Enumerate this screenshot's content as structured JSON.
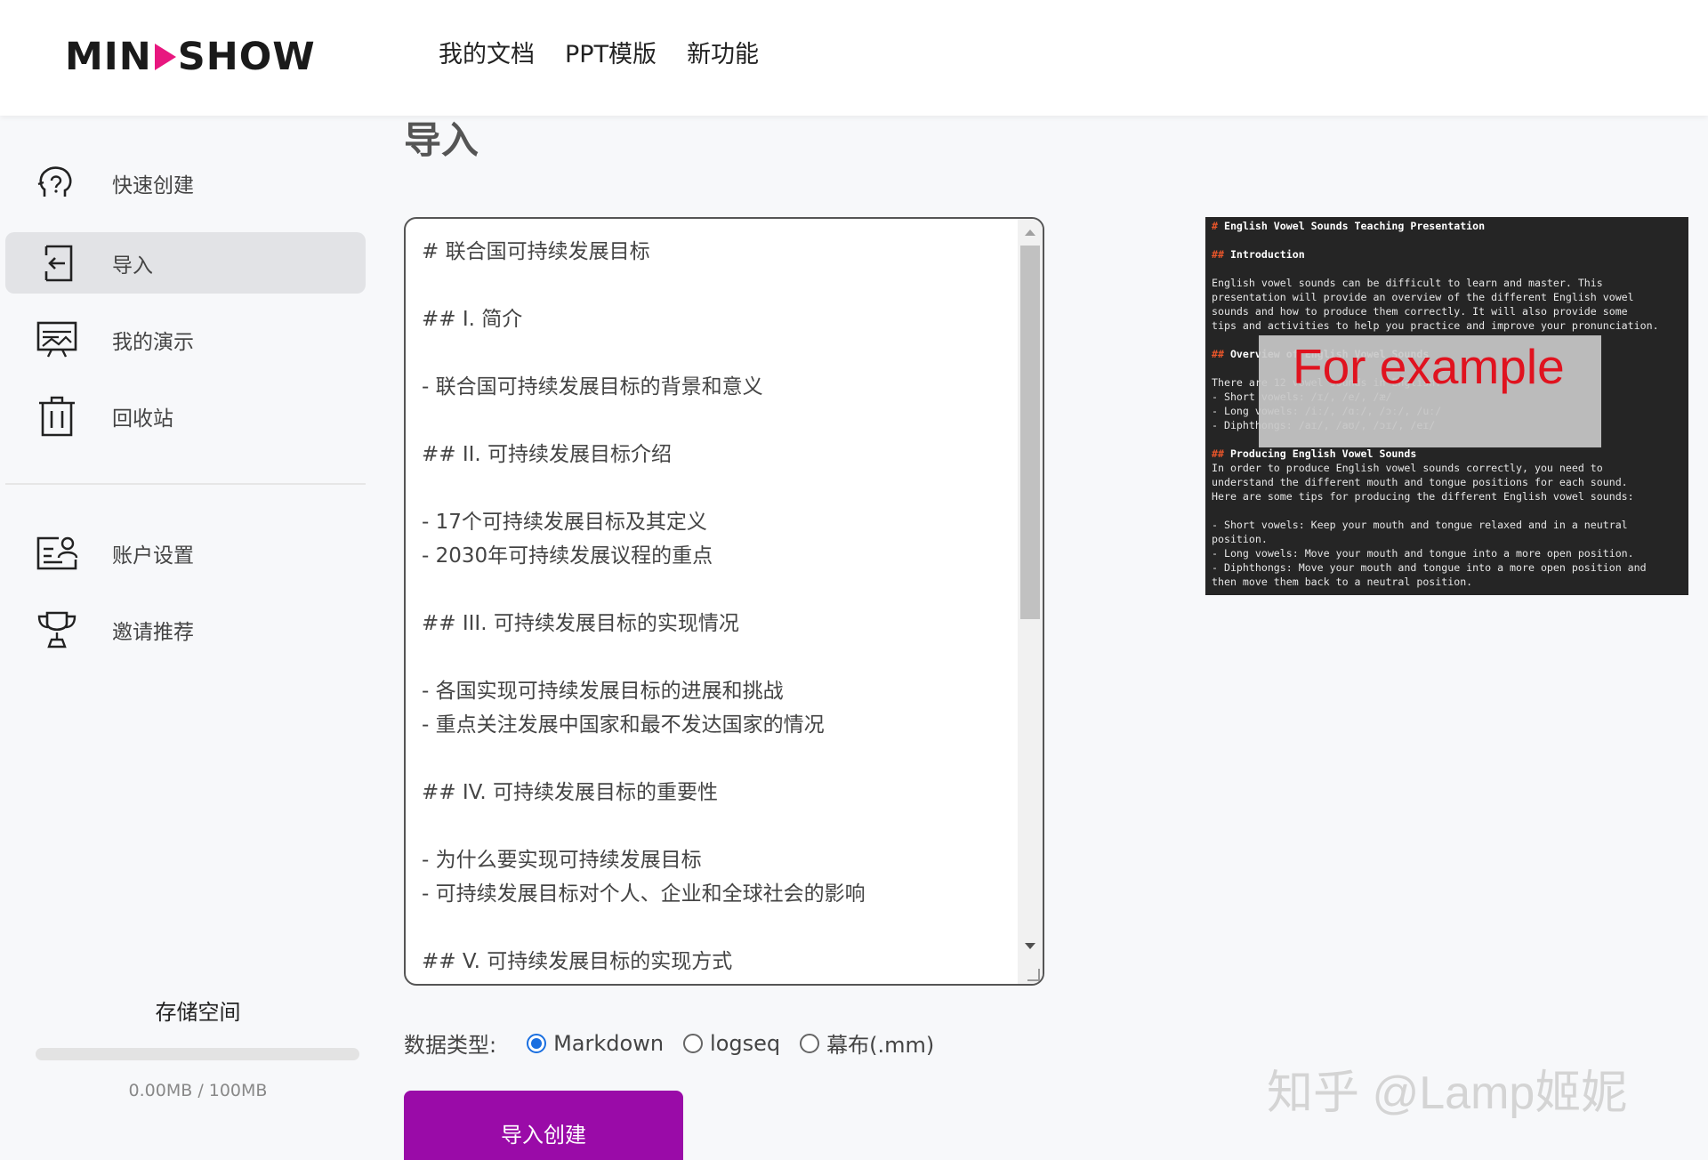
{
  "header": {
    "logo_text_left": "MIN",
    "logo_text_right": "SHOW",
    "logo_accent": "#e8177f",
    "nav": [
      "我的文档",
      "PPT模版",
      "新功能"
    ]
  },
  "sidebar": {
    "items": [
      {
        "label": "快速创建",
        "icon": "brain-idea-icon"
      },
      {
        "label": "导入",
        "icon": "import-icon",
        "active": true
      },
      {
        "label": "我的演示",
        "icon": "presentation-icon"
      },
      {
        "label": "回收站",
        "icon": "trash-icon"
      },
      {
        "label": "账户设置",
        "icon": "account-icon"
      },
      {
        "label": "邀请推荐",
        "icon": "trophy-icon"
      }
    ],
    "storage": {
      "title": "存储空间",
      "usage_text": "0.00MB / 100MB",
      "used_fraction": 0
    }
  },
  "main": {
    "title": "导入",
    "editor_lines": [
      "# 联合国可持续发展目标",
      "",
      "## I. 简介",
      "",
      "- 联合国可持续发展目标的背景和意义",
      "",
      "## II. 可持续发展目标介绍",
      "",
      "- 17个可持续发展目标及其定义",
      "- 2030年可持续发展议程的重点",
      "",
      "## III. 可持续发展目标的实现情况",
      "",
      "- 各国实现可持续发展目标的进展和挑战",
      "- 重点关注发展中国家和最不发达国家的情况",
      "",
      "## IV. 可持续发展目标的重要性",
      "",
      "- 为什么要实现可持续发展目标",
      "- 可持续发展目标对个人、企业和全球社会的影响",
      "",
      "## V. 可持续发展目标的实现方式"
    ],
    "datatype": {
      "label": "数据类型:",
      "options": [
        "Markdown",
        "logseq",
        "幕布(.mm)"
      ],
      "selected": "Markdown"
    },
    "import_button": "导入创建",
    "accent_color": "#9a0ba8"
  },
  "example": {
    "overlay_text": "For example",
    "lines": [
      {
        "k": "h1",
        "m": "#",
        "t": " English Vowel Sounds Teaching Presentation"
      },
      {
        "k": "",
        "t": ""
      },
      {
        "k": "h2",
        "m": "##",
        "t": " Introduction"
      },
      {
        "k": "",
        "t": ""
      },
      {
        "k": "",
        "t": "English vowel sounds can be difficult to learn and master. This"
      },
      {
        "k": "",
        "t": "presentation will provide an overview of the different English vowel"
      },
      {
        "k": "",
        "t": "sounds and how to produce them correctly. It will also provide some"
      },
      {
        "k": "",
        "t": "tips and activities to help you practice and improve your pronunciation."
      },
      {
        "k": "",
        "t": ""
      },
      {
        "k": "h2",
        "m": "##",
        "t": " Overview of English Vowel Sounds"
      },
      {
        "k": "",
        "t": ""
      },
      {
        "k": "",
        "t": "There are 12 vowel sounds in English:"
      },
      {
        "k": "",
        "t": "- Short vowels: /ɪ/, /e/, /æ/"
      },
      {
        "k": "",
        "t": "- Long vowels: /iː/, /ɑː/, /ɔː/, /uː/"
      },
      {
        "k": "",
        "t": "- Diphthongs: /aɪ/, /aʊ/, /ɔɪ/, /eɪ/"
      },
      {
        "k": "",
        "t": ""
      },
      {
        "k": "h2",
        "m": "##",
        "t": " Producing English Vowel Sounds"
      },
      {
        "k": "",
        "t": "In order to produce English vowel sounds correctly, you need to"
      },
      {
        "k": "",
        "t": "understand the different mouth and tongue positions for each sound."
      },
      {
        "k": "",
        "t": "Here are some tips for producing the different English vowel sounds:"
      },
      {
        "k": "",
        "t": ""
      },
      {
        "k": "",
        "t": "- Short vowels: Keep your mouth and tongue relaxed and in a neutral"
      },
      {
        "k": "",
        "t": "position."
      },
      {
        "k": "",
        "t": "- Long vowels: Move your mouth and tongue into a more open position."
      },
      {
        "k": "",
        "t": "- Diphthongs: Move your mouth and tongue into a more open position and"
      },
      {
        "k": "",
        "t": "then move them back to a neutral position."
      }
    ]
  },
  "watermark": "知乎 @Lamp姬妮"
}
